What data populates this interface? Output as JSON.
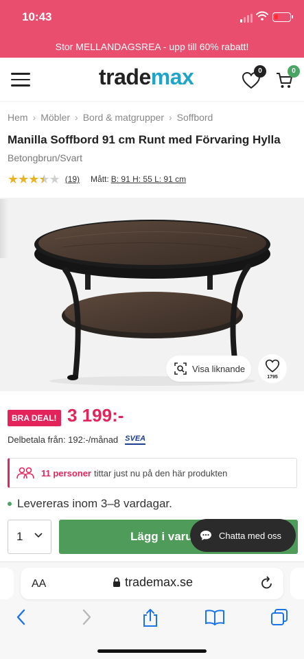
{
  "status_bar": {
    "time": "10:43"
  },
  "promo": {
    "text": "Stor MELLANDAGSREA - upp till 60% rabatt!"
  },
  "header": {
    "logo_part1": "trade",
    "logo_part2": "max",
    "wishlist_count": "0",
    "cart_count": "0",
    "colors": {
      "logo_accent": "#1fa5c9",
      "wishlist_badge": "#222222",
      "cart_badge": "#4aa564"
    }
  },
  "breadcrumb": [
    "Hem",
    "Möbler",
    "Bord & matgrupper",
    "Soffbord"
  ],
  "product": {
    "title": "Manilla Soffbord 91 cm Runt med Förvaring Hylla",
    "subtitle": "Betongbrun/Svart",
    "rating": 3.5,
    "rating_max": 5,
    "review_count": "(19)",
    "dims_label": "Mått:",
    "dims_value": "B: 91 H: 55 L: 91 cm",
    "similar_label": "Visa liknande",
    "favorite_count": "1795"
  },
  "pricing": {
    "deal_badge": "BRA DEAL!",
    "price": "3 199:-",
    "installment": "Delbetala från: 192:-/månad",
    "installment_provider": "SVEA",
    "price_color": "#e2245a"
  },
  "viewers": {
    "highlight": "11 personer",
    "rest": "tittar just nu på den här produkten"
  },
  "delivery": {
    "text": "Levereras inom 3–8 vardagar."
  },
  "purchase": {
    "quantity": "1",
    "add_to_cart": "Lägg i varul",
    "chat": "Chatta med oss",
    "button_color": "#4f9b5a"
  },
  "browser": {
    "text_size": "AA",
    "url": "trademax.se"
  }
}
